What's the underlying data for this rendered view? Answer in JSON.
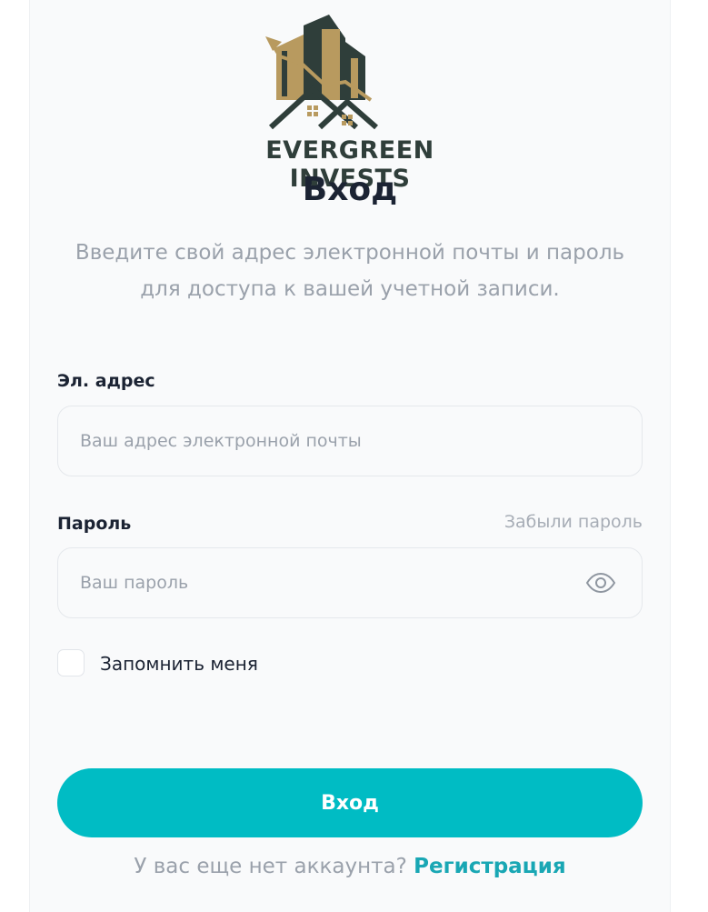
{
  "brand": {
    "name": "EVERGREEN INVESTS",
    "colors": {
      "dark": "#2f3e3a",
      "gold": "#b89a5f",
      "accent": "#00bcc4"
    },
    "logo_icon": "buildings-chart-logo"
  },
  "header": {
    "title": "Вход",
    "subtitle": "Введите свой адрес электронной почты и пароль для доступа к вашей учетной записи."
  },
  "form": {
    "email": {
      "label": "Эл. адрес",
      "placeholder": "Ваш адрес электронной почты",
      "value": ""
    },
    "password": {
      "label": "Пароль",
      "placeholder": "Ваш пароль",
      "value": "",
      "forgot_label": "Забыли пароль",
      "toggle_icon": "eye-icon"
    },
    "remember": {
      "label": "Запомнить меня",
      "checked": false
    },
    "submit_label": "Вход"
  },
  "footer": {
    "prompt": "У вас еще нет аккаунта?",
    "register_label": "Регистрация"
  }
}
